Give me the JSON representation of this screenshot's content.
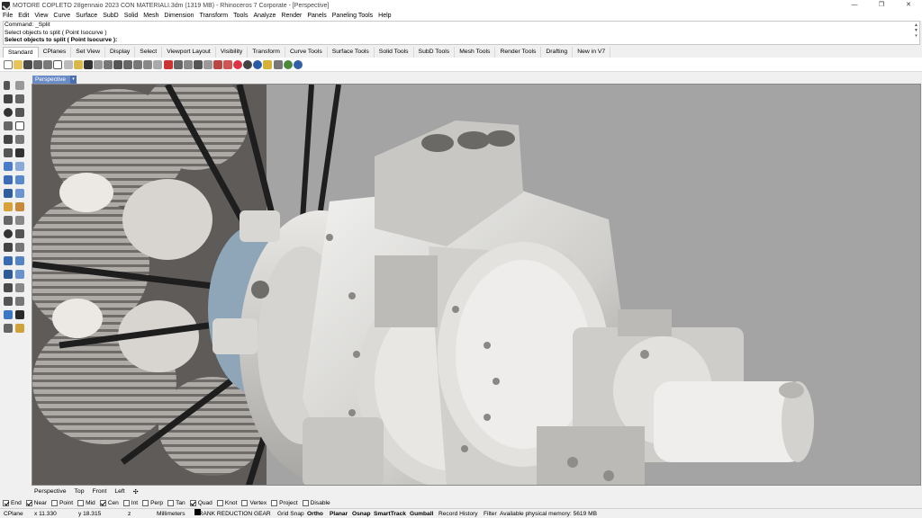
{
  "window": {
    "title": "MOTORE COPLETO 28gennaio 2023 CON MATERIALI.3dm (1319 MB) - Rhinoceros 7 Corporate - [Perspective]",
    "controls": [
      "—",
      "❐",
      "✕"
    ]
  },
  "menu": [
    "File",
    "Edit",
    "View",
    "Curve",
    "Surface",
    "SubD",
    "Solid",
    "Mesh",
    "Dimension",
    "Transform",
    "Tools",
    "Analyze",
    "Render",
    "Panels",
    "Paneling Tools",
    "Help"
  ],
  "command_history": {
    "line1": "Command: _Split",
    "line2": "Select objects to split ( Point  Isocurve )",
    "prompt": "Select objects to split ( Point  Isocurve ):"
  },
  "toolbar_tabs": [
    "Standard",
    "CPlanes",
    "Set View",
    "Display",
    "Select",
    "Viewport Layout",
    "Visibility",
    "Transform",
    "Curve Tools",
    "Surface Tools",
    "Solid Tools",
    "SubD Tools",
    "Mesh Tools",
    "Render Tools",
    "Drafting",
    "New in V7"
  ],
  "viewport": {
    "active_label": "Perspective"
  },
  "viewport_tabs": [
    "Perspective",
    "Top",
    "Front",
    "Left",
    "✣"
  ],
  "osnaps": [
    {
      "label": "End",
      "checked": true
    },
    {
      "label": "Near",
      "checked": true
    },
    {
      "label": "Point",
      "checked": false
    },
    {
      "label": "Mid",
      "checked": false
    },
    {
      "label": "Cen",
      "checked": true
    },
    {
      "label": "Int",
      "checked": false
    },
    {
      "label": "Perp",
      "checked": false
    },
    {
      "label": "Tan",
      "checked": false
    },
    {
      "label": "Quad",
      "checked": true
    },
    {
      "label": "Knot",
      "checked": false
    },
    {
      "label": "Vertex",
      "checked": false
    },
    {
      "label": "Project",
      "checked": false
    },
    {
      "label": "Disable",
      "checked": false
    }
  ],
  "status": {
    "cplane": "CPlane",
    "x": "x 11.330",
    "y": "y 18.315",
    "z": "z",
    "units": "Millimeters",
    "layer": "CRANK REDUCTION GEAR",
    "grid_snap": "Grid Snap",
    "ortho": "Ortho",
    "planar": "Planar",
    "osnap": "Osnap",
    "smarttrack": "SmartTrack",
    "gumball": "Gumball",
    "record_history": "Record History",
    "filter": "Filter",
    "memory": "Available physical memory: 5619 MB"
  }
}
